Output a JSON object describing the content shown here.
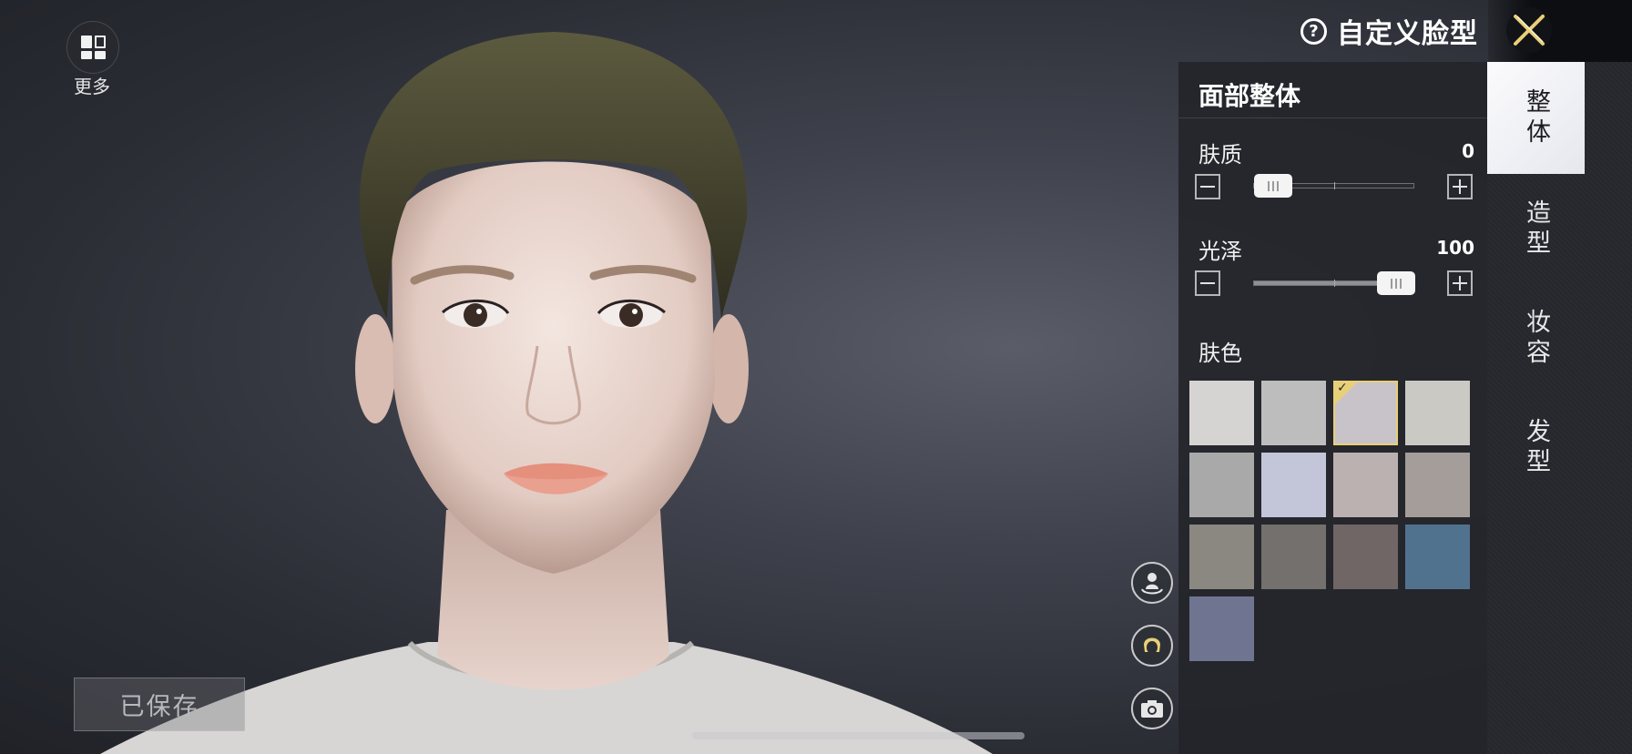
{
  "header": {
    "title": "自定义脸型",
    "help_icon": "question-circle-icon",
    "close_icon": "close-x-icon"
  },
  "more": {
    "label": "更多",
    "icon": "grid-icon"
  },
  "save": {
    "label": "已保存"
  },
  "panel": {
    "title": "面部整体",
    "sliders": [
      {
        "label": "肤质",
        "value": "0",
        "level": 0
      },
      {
        "label": "光泽",
        "value": "100",
        "level": 1
      }
    ],
    "skin_color": {
      "label": "肤色",
      "selected_index": 2,
      "swatches": [
        "#d6d3d3",
        "#bdbdbd",
        "#c8c3c9",
        "#cbc9c4",
        "#a9a9aa",
        "#c3c6d8",
        "#bbb1b1",
        "#a49d99",
        "#8b8882",
        "#73706d",
        "#6f6665",
        "#51728f",
        "#6f7490"
      ]
    }
  },
  "side_icons": [
    "person-rotate-icon",
    "hair-preview-icon",
    "camera-icon"
  ],
  "tabs": [
    {
      "label": "整体",
      "active": true
    },
    {
      "label": "造型",
      "active": false
    },
    {
      "label": "妆容",
      "active": false
    },
    {
      "label": "发型",
      "active": false
    }
  ],
  "colors": {
    "accent_gold": "#e9cf78",
    "panel_bg": "#24252a"
  }
}
